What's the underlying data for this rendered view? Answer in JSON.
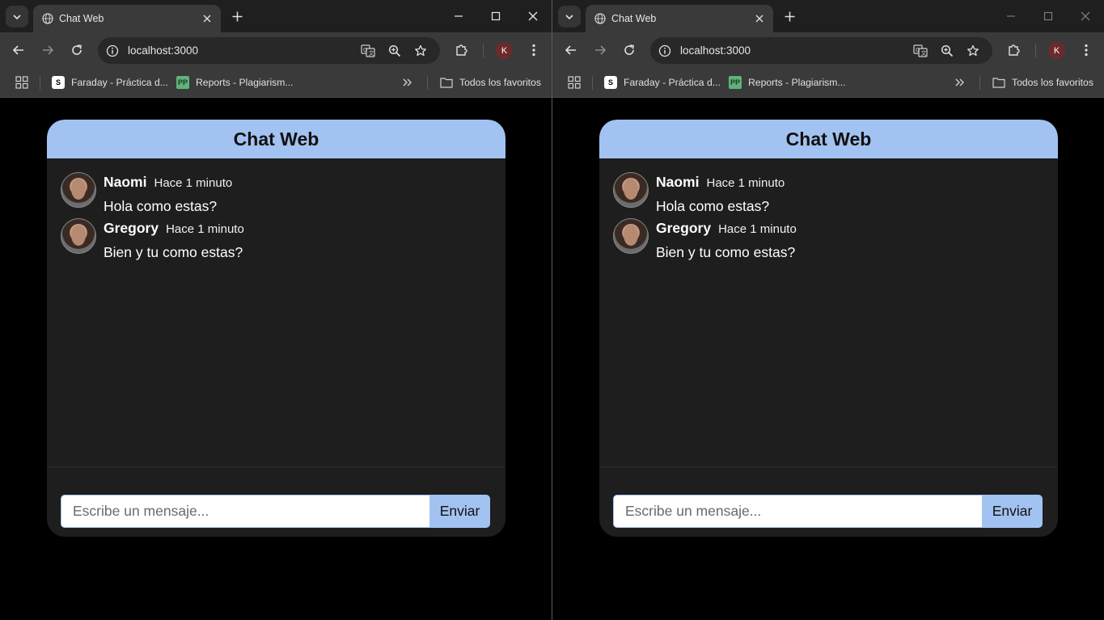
{
  "windows": [
    {
      "tab_title": "Chat Web",
      "url": "localhost:3000",
      "profile_initial": "K",
      "bookmarks": [
        {
          "label": "Faraday - Práctica d...",
          "icon": "S"
        },
        {
          "label": "Reports - Plagiarism...",
          "icon": "PP"
        }
      ],
      "all_bookmarks_label": "Todos los favoritos",
      "chat": {
        "title": "Chat Web",
        "messages": [
          {
            "name": "Naomi",
            "time": "Hace 1 minuto",
            "text": "Hola como estas?"
          },
          {
            "name": "Gregory",
            "time": "Hace 1 minuto",
            "text": "Bien y tu como estas?"
          }
        ],
        "input_placeholder": "Escribe un mensaje...",
        "send_label": "Enviar"
      }
    },
    {
      "tab_title": "Chat Web",
      "url": "localhost:3000",
      "profile_initial": "K",
      "bookmarks": [
        {
          "label": "Faraday - Práctica d...",
          "icon": "S"
        },
        {
          "label": "Reports - Plagiarism...",
          "icon": "PP"
        }
      ],
      "all_bookmarks_label": "Todos los favoritos",
      "chat": {
        "title": "Chat Web",
        "messages": [
          {
            "name": "Naomi",
            "time": "Hace 1 minuto",
            "text": "Hola como estas?"
          },
          {
            "name": "Gregory",
            "time": "Hace 1 minuto",
            "text": "Bien y tu como estas?"
          }
        ],
        "input_placeholder": "Escribe un mensaje...",
        "send_label": "Enviar"
      }
    }
  ],
  "colors": {
    "accent": "#a2c2f1",
    "card_bg": "#1e1e1f",
    "page_bg": "#000000",
    "chrome_bg": "#3a3a3a"
  }
}
